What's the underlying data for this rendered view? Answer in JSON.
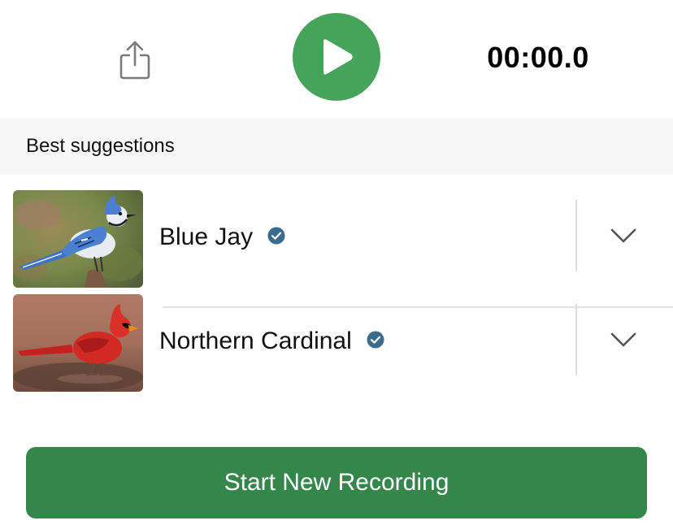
{
  "header": {
    "share_icon": "share-icon",
    "play_icon": "play-icon",
    "timer": "00:00.0",
    "play_color": "#46a35a"
  },
  "section": {
    "title": "Best suggestions"
  },
  "suggestions": [
    {
      "name": "Blue Jay",
      "image_icon": "blue-jay-photo",
      "verified_icon": "verified-badge-icon",
      "expand_icon": "chevron-down-icon"
    },
    {
      "name": "Northern Cardinal",
      "image_icon": "northern-cardinal-photo",
      "verified_icon": "verified-badge-icon",
      "expand_icon": "chevron-down-icon"
    }
  ],
  "footer": {
    "start_label": "Start New Recording",
    "button_color": "#35864a"
  }
}
